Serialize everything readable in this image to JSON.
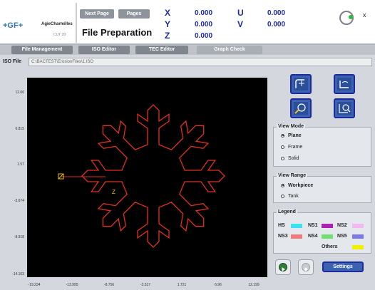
{
  "brand": {
    "logo": "+GF+",
    "name": "AgieCharmilles",
    "model": "CUT 20"
  },
  "header": {
    "next_page": "Next Page",
    "pages": "Pages",
    "title": "File Preparation",
    "close": "x"
  },
  "axes": [
    {
      "label": "X",
      "value": "0.000"
    },
    {
      "label": "Y",
      "value": "0.000"
    },
    {
      "label": "Z",
      "value": "0.000"
    },
    {
      "label": "U",
      "value": "0.000"
    },
    {
      "label": "V",
      "value": "0.000"
    }
  ],
  "tabs": [
    {
      "label": "File Management"
    },
    {
      "label": "ISO Editor"
    },
    {
      "label": "TEC Editor"
    },
    {
      "label": "Graph Check"
    }
  ],
  "active_tab": "Graph Check",
  "iso_file": {
    "label": "ISO File",
    "value": "C:\\BACTEST\\ErosionFiles\\1.ISO"
  },
  "graph": {
    "y_ticks": [
      "12.06",
      "6.815",
      "1.57",
      "-3.674",
      "-8.918",
      "-14.163"
    ],
    "x_ticks": [
      "-19.234",
      "-13.995",
      "-8.756",
      "-3.517",
      "1.721",
      "6.96",
      "12.199"
    ],
    "shape_color": "#e0301e",
    "marker_color": "#e8c400"
  },
  "view_mode": {
    "title": "View Mode",
    "options": [
      "Plane",
      "Frame",
      "Solid"
    ],
    "selected": "Plane"
  },
  "view_range": {
    "title": "View Range",
    "options": [
      "Workpiece",
      "Tank"
    ],
    "selected": "Workpiece"
  },
  "legend": {
    "title": "Legend",
    "items": [
      {
        "label": "HS",
        "color": "#40e0f0"
      },
      {
        "label": "NS1",
        "color": "#b020b0"
      },
      {
        "label": "NS2",
        "color": "#f4b8f0"
      },
      {
        "label": "NS3",
        "color": "#f07a7a"
      },
      {
        "label": "NS4",
        "color": "#70e070"
      },
      {
        "label": "NS5",
        "color": "#7a7ae8"
      },
      {
        "label": "Others",
        "color": "#f0f000"
      }
    ]
  },
  "settings_label": "Settings",
  "tool_icons": [
    "zoom-fit-icon",
    "zoom-window-icon",
    "pan-icon",
    "zoom-magnify-icon"
  ]
}
